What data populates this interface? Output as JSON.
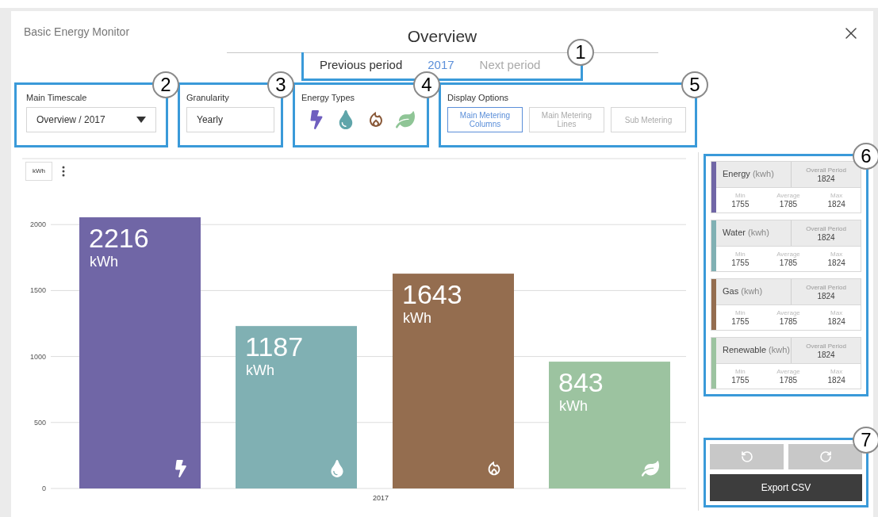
{
  "app_title": "Basic Energy Monitor",
  "page_title": "Overview",
  "period_nav": {
    "callout": "1",
    "previous": {
      "label": "Previous period",
      "disabled": false
    },
    "current": "2017",
    "next": {
      "label": "Next period",
      "disabled": true
    }
  },
  "main_timescale": {
    "callout": "2",
    "label": "Main Timescale",
    "value": "Overview / 2017"
  },
  "granularity": {
    "callout": "3",
    "label": "Granularity",
    "value": "Yearly"
  },
  "energy_types": {
    "callout": "4",
    "label": "Energy Types",
    "items": [
      {
        "kind": "electricity",
        "color": "#6f5fbf",
        "on": true
      },
      {
        "kind": "water",
        "color": "#5fa5aa",
        "on": true
      },
      {
        "kind": "gas",
        "color": "#8a5a3a",
        "on": true
      },
      {
        "kind": "renewable",
        "color": "#8fc596",
        "on": true
      }
    ]
  },
  "display_options": {
    "callout": "5",
    "label": "Display Options",
    "buttons": [
      {
        "label": "Main Metering Columns",
        "selected": true
      },
      {
        "label": "Main Metering Lines",
        "selected": false
      },
      {
        "label": "Sub Metering",
        "selected": false
      }
    ]
  },
  "chart_toolbar": {
    "unit_button": "kWh"
  },
  "chart_data": {
    "type": "bar",
    "grid": true,
    "categories": [
      "2017"
    ],
    "ylim": [
      0,
      2500
    ],
    "yticks": [
      0,
      500,
      1000,
      1500,
      2000
    ],
    "series": [
      {
        "color": "#7066a6",
        "values": [
          2055
        ]
      },
      {
        "color": "#80b0b3",
        "values": [
          1231
        ]
      },
      {
        "color": "#946d4f",
        "values": [
          1628
        ]
      },
      {
        "color": "#9cc3a0",
        "values": [
          961
        ]
      }
    ]
  },
  "bar_labels": [
    {
      "kind": "electricity",
      "value": "2216",
      "unit": "kWh"
    },
    {
      "kind": "water",
      "value": "1187",
      "unit": "kWh"
    },
    {
      "kind": "gas",
      "value": "1643",
      "unit": "kWh"
    },
    {
      "kind": "renewable",
      "value": "843",
      "unit": "kWh"
    }
  ],
  "summary": {
    "callout": "6",
    "cards": [
      {
        "name": "Energy",
        "unit": "(kwh)",
        "color": "#7066a6",
        "overall_label": "Overall Period",
        "overall": "1824",
        "min_label": "Min",
        "min": "1755",
        "avg_label": "Average",
        "avg": "1785",
        "max_label": "Max",
        "max": "1824"
      },
      {
        "name": "Water",
        "unit": "(kwh)",
        "color": "#80b0b3",
        "overall_label": "Overall Period",
        "overall": "1824",
        "min_label": "Min",
        "min": "1755",
        "avg_label": "Average",
        "avg": "1785",
        "max_label": "Max",
        "max": "1824"
      },
      {
        "name": "Gas",
        "unit": "(kwh)",
        "color": "#946d4f",
        "overall_label": "Overall Period",
        "overall": "1824",
        "min_label": "Min",
        "min": "1755",
        "avg_label": "Average",
        "avg": "1785",
        "max_label": "Max",
        "max": "1824"
      },
      {
        "name": "Renewable",
        "unit": "(kwh)",
        "color": "#9cc3a0",
        "overall_label": "Overall Period",
        "overall": "1824",
        "min_label": "Min",
        "min": "1755",
        "avg_label": "Average",
        "avg": "1785",
        "max_label": "Max",
        "max": "1824"
      }
    ]
  },
  "actions": {
    "callout": "7",
    "export_button": "Export CSV"
  }
}
